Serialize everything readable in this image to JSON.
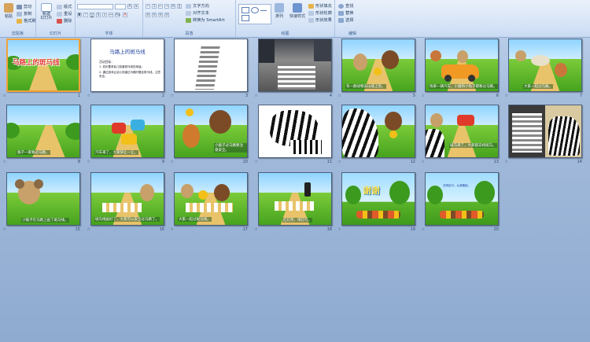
{
  "ribbon": {
    "clipboard": {
      "paste": "粘贴",
      "cut": "剪切",
      "copy": "复制",
      "format_painter": "格式刷",
      "label": "剪贴板"
    },
    "slides": {
      "new_slide": "新建\n幻灯片",
      "layout": "版式",
      "reset": "重设",
      "delete": "删除",
      "label": "幻灯片"
    },
    "font": {
      "label": "字体"
    },
    "paragraph": {
      "text_direction": "文字方向",
      "align_text": "对齐文本",
      "smartart": "转换为 SmartArt",
      "label": "段落"
    },
    "drawing": {
      "arrange": "排列",
      "quick_styles": "快速样式",
      "fill": "形状填充",
      "outline": "形状轮廓",
      "effects": "形状效果",
      "label": "绘图"
    },
    "editing": {
      "find": "查找",
      "replace": "替换",
      "select": "选择",
      "label": "编辑"
    }
  },
  "slides": [
    {
      "num": "1",
      "title": "马路上的斑马线",
      "selected": true
    },
    {
      "num": "2",
      "title": "马路上的斑马线",
      "line1": "活动目标：",
      "line2": "1. 初步要求幼儿知道斑马线的用途。",
      "line3": "2. 通过游戏让幼儿知道过马路时要走斑马线，注意安全。"
    },
    {
      "num": "3"
    },
    {
      "num": "4"
    },
    {
      "num": "5",
      "caption": "有一群动物去山坡上玩。"
    },
    {
      "num": "6",
      "caption": "快来一辆汽车，小猴和小兔子都要过马路。"
    },
    {
      "num": "7",
      "caption": "大家一起过马路。"
    },
    {
      "num": "8",
      "caption": "猴子一家要过马路。"
    },
    {
      "num": "9",
      "caption": "汽车来了，大家快让一让。"
    },
    {
      "num": "10",
      "caption": "小猴子过马路要注意安全。"
    },
    {
      "num": "11"
    },
    {
      "num": "12"
    },
    {
      "num": "13",
      "caption": "斑马来了，大家都去找斑马。"
    },
    {
      "num": "14"
    },
    {
      "num": "15",
      "caption": "小猴子在马路上画了斑马线。"
    },
    {
      "num": "16",
      "caption": "斑马线画好了，大家可以安全过马路了。"
    },
    {
      "num": "17",
      "caption": "大家一起过斑马线。"
    },
    {
      "num": "18",
      "caption": "红灯停，绿灯行。"
    },
    {
      "num": "19",
      "title": "谢谢"
    },
    {
      "num": "20",
      "caption": "文明出行，从我做起。"
    }
  ],
  "colors": {
    "selected_border": "#f0a23a",
    "grass": "#5bb42a",
    "road": "#e8c36a"
  }
}
